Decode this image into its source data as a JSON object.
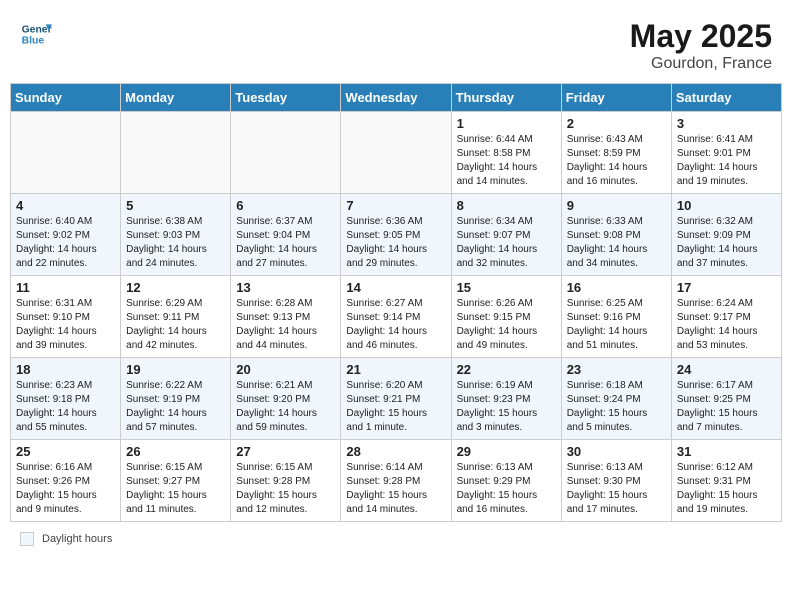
{
  "header": {
    "logo_general": "General",
    "logo_blue": "Blue",
    "month_year": "May 2025",
    "location": "Gourdon, France"
  },
  "days_of_week": [
    "Sunday",
    "Monday",
    "Tuesday",
    "Wednesday",
    "Thursday",
    "Friday",
    "Saturday"
  ],
  "weeks": [
    [
      {
        "day": "",
        "info": ""
      },
      {
        "day": "",
        "info": ""
      },
      {
        "day": "",
        "info": ""
      },
      {
        "day": "",
        "info": ""
      },
      {
        "day": "1",
        "info": "Sunrise: 6:44 AM\nSunset: 8:58 PM\nDaylight: 14 hours and 14 minutes."
      },
      {
        "day": "2",
        "info": "Sunrise: 6:43 AM\nSunset: 8:59 PM\nDaylight: 14 hours and 16 minutes."
      },
      {
        "day": "3",
        "info": "Sunrise: 6:41 AM\nSunset: 9:01 PM\nDaylight: 14 hours and 19 minutes."
      }
    ],
    [
      {
        "day": "4",
        "info": "Sunrise: 6:40 AM\nSunset: 9:02 PM\nDaylight: 14 hours and 22 minutes."
      },
      {
        "day": "5",
        "info": "Sunrise: 6:38 AM\nSunset: 9:03 PM\nDaylight: 14 hours and 24 minutes."
      },
      {
        "day": "6",
        "info": "Sunrise: 6:37 AM\nSunset: 9:04 PM\nDaylight: 14 hours and 27 minutes."
      },
      {
        "day": "7",
        "info": "Sunrise: 6:36 AM\nSunset: 9:05 PM\nDaylight: 14 hours and 29 minutes."
      },
      {
        "day": "8",
        "info": "Sunrise: 6:34 AM\nSunset: 9:07 PM\nDaylight: 14 hours and 32 minutes."
      },
      {
        "day": "9",
        "info": "Sunrise: 6:33 AM\nSunset: 9:08 PM\nDaylight: 14 hours and 34 minutes."
      },
      {
        "day": "10",
        "info": "Sunrise: 6:32 AM\nSunset: 9:09 PM\nDaylight: 14 hours and 37 minutes."
      }
    ],
    [
      {
        "day": "11",
        "info": "Sunrise: 6:31 AM\nSunset: 9:10 PM\nDaylight: 14 hours and 39 minutes."
      },
      {
        "day": "12",
        "info": "Sunrise: 6:29 AM\nSunset: 9:11 PM\nDaylight: 14 hours and 42 minutes."
      },
      {
        "day": "13",
        "info": "Sunrise: 6:28 AM\nSunset: 9:13 PM\nDaylight: 14 hours and 44 minutes."
      },
      {
        "day": "14",
        "info": "Sunrise: 6:27 AM\nSunset: 9:14 PM\nDaylight: 14 hours and 46 minutes."
      },
      {
        "day": "15",
        "info": "Sunrise: 6:26 AM\nSunset: 9:15 PM\nDaylight: 14 hours and 49 minutes."
      },
      {
        "day": "16",
        "info": "Sunrise: 6:25 AM\nSunset: 9:16 PM\nDaylight: 14 hours and 51 minutes."
      },
      {
        "day": "17",
        "info": "Sunrise: 6:24 AM\nSunset: 9:17 PM\nDaylight: 14 hours and 53 minutes."
      }
    ],
    [
      {
        "day": "18",
        "info": "Sunrise: 6:23 AM\nSunset: 9:18 PM\nDaylight: 14 hours and 55 minutes."
      },
      {
        "day": "19",
        "info": "Sunrise: 6:22 AM\nSunset: 9:19 PM\nDaylight: 14 hours and 57 minutes."
      },
      {
        "day": "20",
        "info": "Sunrise: 6:21 AM\nSunset: 9:20 PM\nDaylight: 14 hours and 59 minutes."
      },
      {
        "day": "21",
        "info": "Sunrise: 6:20 AM\nSunset: 9:21 PM\nDaylight: 15 hours and 1 minute."
      },
      {
        "day": "22",
        "info": "Sunrise: 6:19 AM\nSunset: 9:23 PM\nDaylight: 15 hours and 3 minutes."
      },
      {
        "day": "23",
        "info": "Sunrise: 6:18 AM\nSunset: 9:24 PM\nDaylight: 15 hours and 5 minutes."
      },
      {
        "day": "24",
        "info": "Sunrise: 6:17 AM\nSunset: 9:25 PM\nDaylight: 15 hours and 7 minutes."
      }
    ],
    [
      {
        "day": "25",
        "info": "Sunrise: 6:16 AM\nSunset: 9:26 PM\nDaylight: 15 hours and 9 minutes."
      },
      {
        "day": "26",
        "info": "Sunrise: 6:15 AM\nSunset: 9:27 PM\nDaylight: 15 hours and 11 minutes."
      },
      {
        "day": "27",
        "info": "Sunrise: 6:15 AM\nSunset: 9:28 PM\nDaylight: 15 hours and 12 minutes."
      },
      {
        "day": "28",
        "info": "Sunrise: 6:14 AM\nSunset: 9:28 PM\nDaylight: 15 hours and 14 minutes."
      },
      {
        "day": "29",
        "info": "Sunrise: 6:13 AM\nSunset: 9:29 PM\nDaylight: 15 hours and 16 minutes."
      },
      {
        "day": "30",
        "info": "Sunrise: 6:13 AM\nSunset: 9:30 PM\nDaylight: 15 hours and 17 minutes."
      },
      {
        "day": "31",
        "info": "Sunrise: 6:12 AM\nSunset: 9:31 PM\nDaylight: 15 hours and 19 minutes."
      }
    ]
  ],
  "legend": {
    "label": "Daylight hours"
  }
}
